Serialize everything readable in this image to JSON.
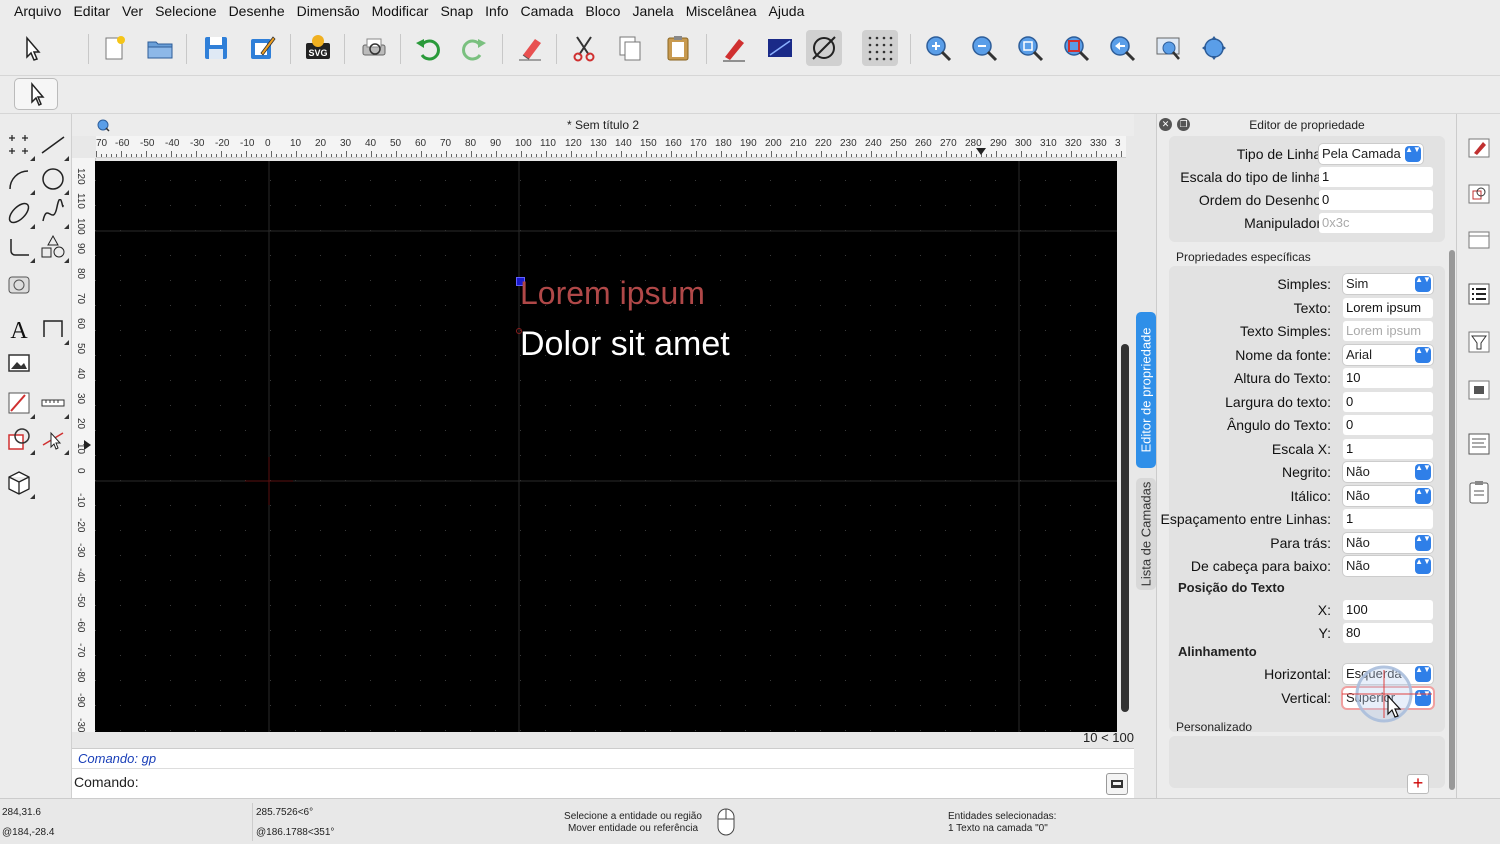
{
  "menu": [
    "Arquivo",
    "Editar",
    "Ver",
    "Selecione",
    "Desenhe",
    "Dimensão",
    "Modificar",
    "Snap",
    "Info",
    "Camada",
    "Bloco",
    "Janela",
    "Miscelânea",
    "Ajuda"
  ],
  "toolbar": {
    "icons": [
      "select-pointer-icon",
      "new-document-icon",
      "open-folder-icon",
      "save-icon",
      "save-as-icon",
      "export-svg-icon",
      "print-preview-icon",
      "undo-icon",
      "redo-icon",
      "eraser-icon",
      "cut-icon",
      "copy-icon",
      "paste-icon",
      "pen-icon",
      "draw-order-icon",
      "no-snap-icon",
      "grid-snap-icon",
      "zoom-in-icon",
      "zoom-out-icon",
      "zoom-auto-icon",
      "zoom-window-icon",
      "zoom-previous-icon",
      "zoom-redraw-icon",
      "pan-icon"
    ],
    "svg_label": "SVG"
  },
  "document": {
    "title": "* Sem título 2",
    "ruler_h": [
      "70",
      "-60",
      "-50",
      "-40",
      "-30",
      "-20",
      "-10",
      "0",
      "10",
      "20",
      "30",
      "40",
      "50",
      "60",
      "70",
      "80",
      "90",
      "100",
      "110",
      "120",
      "130",
      "140",
      "150",
      "160",
      "170",
      "180",
      "190",
      "200",
      "210",
      "220",
      "230",
      "240",
      "250",
      "260",
      "270",
      "280",
      "290",
      "300",
      "310",
      "320",
      "330",
      "3"
    ],
    "ruler_v": [
      "120",
      "110",
      "100",
      "90",
      "80",
      "70",
      "60",
      "50",
      "40",
      "30",
      "20",
      "10",
      "0",
      "-10",
      "-20",
      "-30",
      "-40",
      "-50",
      "-60",
      "-70",
      "-80",
      "-90",
      "-30"
    ],
    "text_line1": "Lorem ipsum",
    "text_line2": "Dolor sit amet",
    "grid_info": "10 < 100"
  },
  "command": {
    "history": "Comando: gp",
    "prompt": "Comando:"
  },
  "docked_tabs": {
    "property_editor": "Editor de propriedade",
    "layer_list": "Lista de Camadas"
  },
  "property_editor": {
    "title": "Editor de propriedade",
    "general": [
      {
        "label": "Tipo de Linha:",
        "value": "Pela Camada",
        "kind": "select"
      },
      {
        "label": "Escala do tipo de linha:",
        "value": "1",
        "kind": "field"
      },
      {
        "label": "Ordem do Desenho:",
        "value": "0",
        "kind": "field"
      },
      {
        "label": "Manipulador:",
        "value": "0x3c",
        "kind": "dim"
      }
    ],
    "specific_title": "Propriedades específicas",
    "specific": [
      {
        "label": "Simples:",
        "value": "Sim",
        "kind": "select"
      },
      {
        "label": "Texto:",
        "value": "Lorem ipsum",
        "kind": "field"
      },
      {
        "label": "Texto Simples:",
        "value": "Lorem ipsum",
        "kind": "dim"
      },
      {
        "label": "Nome da fonte:",
        "value": "Arial",
        "kind": "select"
      },
      {
        "label": "Altura do Texto:",
        "value": "10",
        "kind": "field"
      },
      {
        "label": "Largura do texto:",
        "value": "0",
        "kind": "field"
      },
      {
        "label": "Ângulo do Texto:",
        "value": "0",
        "kind": "field"
      },
      {
        "label": "Escala X:",
        "value": "1",
        "kind": "field"
      },
      {
        "label": "Negrito:",
        "value": "Não",
        "kind": "select"
      },
      {
        "label": "Itálico:",
        "value": "Não",
        "kind": "select"
      },
      {
        "label": "Espaçamento entre Linhas:",
        "value": "1",
        "kind": "field"
      },
      {
        "label": "Para trás:",
        "value": "Não",
        "kind": "select"
      },
      {
        "label": "De cabeça para baixo:",
        "value": "Não",
        "kind": "select"
      }
    ],
    "position_title": "Posição do Texto",
    "position": [
      {
        "label": "X:",
        "value": "100"
      },
      {
        "label": "Y:",
        "value": "80"
      }
    ],
    "alignment_title": "Alinhamento",
    "alignment": [
      {
        "label": "Horizontal:",
        "value": "Esquerda"
      },
      {
        "label": "Vertical:",
        "value": "Superior"
      }
    ],
    "custom_title": "Personalizado",
    "add_label": "+"
  },
  "status": {
    "coord_abs": "284,31.6",
    "coord_rel": "@184,-28.4",
    "polar_abs": "285.7526<6°",
    "polar_rel": "@186.1788<351°",
    "mouse_left": "Selecione a entidade ou região",
    "mouse_right": "Mover entidade ou referência",
    "selection_title": "Entidades selecionadas:",
    "selection_detail": "1 Texto na camada \"0\""
  },
  "colors": {
    "canvas": "#000000",
    "text_red": "#b04848",
    "accent": "#2f8fe8"
  }
}
